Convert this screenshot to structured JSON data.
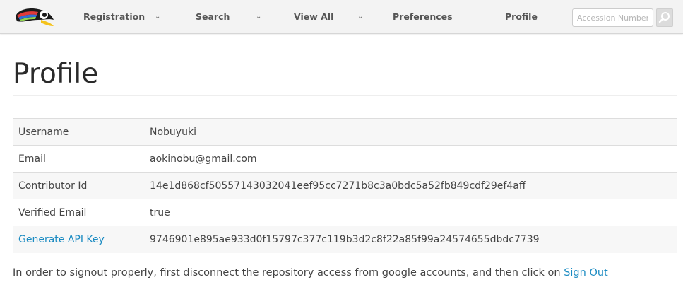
{
  "navbar": {
    "items": [
      {
        "label": "Registration",
        "has_dropdown": true
      },
      {
        "label": "Search",
        "has_dropdown": true
      },
      {
        "label": "View All",
        "has_dropdown": true
      },
      {
        "label": "Preferences",
        "has_dropdown": false
      },
      {
        "label": "Profile",
        "has_dropdown": false
      }
    ],
    "caret_glyph": "⌄",
    "search": {
      "placeholder": "Accession Number",
      "value": "",
      "icon": "search-icon"
    },
    "logo_icon": "toucan-logo"
  },
  "page": {
    "title": "Profile"
  },
  "profile": {
    "rows": [
      {
        "label": "Username",
        "value": "Nobuyuki"
      },
      {
        "label": "Email",
        "value": "aokinobu@gmail.com"
      },
      {
        "label": "Contributor Id",
        "value": "14e1d868cf50557143032041eef95cc7271b8c3a0bdc5a52fb849cdf29ef4aff"
      },
      {
        "label": "Verified Email",
        "value": "true"
      },
      {
        "label": "Generate API Key",
        "value": "9746901e895ae933d0f15797c377c119b3d2c8f22a85f99a24574655dbdc7739"
      }
    ]
  },
  "footer": {
    "text": "In order to signout properly, first disconnect the repository access from google accounts, and then click on",
    "signout_link": "Sign Out"
  },
  "colors": {
    "link": "#1b8bc2",
    "navbar_bg": "#f3f3f3",
    "row_stripe": "#f7f7f7"
  }
}
